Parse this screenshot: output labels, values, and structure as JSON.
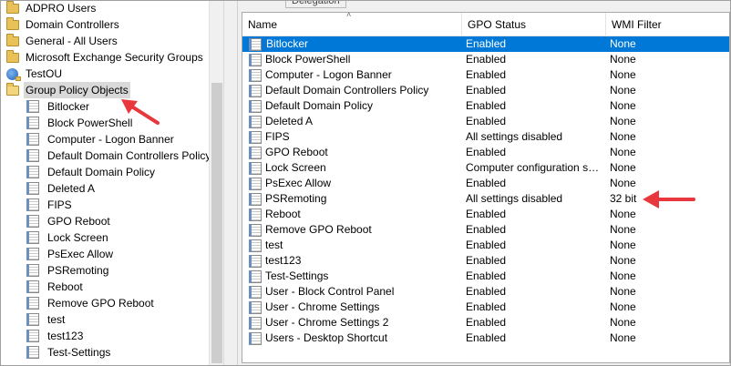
{
  "tree": {
    "items": [
      {
        "label": "ADPRO Users",
        "icon": "folder-icon",
        "level": 0
      },
      {
        "label": "Domain Controllers",
        "icon": "folder-icon",
        "level": 0
      },
      {
        "label": "General - All Users",
        "icon": "folder-icon",
        "level": 0
      },
      {
        "label": "Microsoft Exchange Security Groups",
        "icon": "folder-icon",
        "level": 0
      },
      {
        "label": "TestOU",
        "icon": "ou-icon",
        "level": 0
      },
      {
        "label": "Group Policy Objects",
        "icon": "folder-open-icon",
        "level": 0,
        "selected": true
      },
      {
        "label": "Bitlocker",
        "icon": "gpo-icon",
        "level": 1
      },
      {
        "label": "Block PowerShell",
        "icon": "gpo-icon",
        "level": 1
      },
      {
        "label": "Computer - Logon Banner",
        "icon": "gpo-icon",
        "level": 1
      },
      {
        "label": "Default Domain Controllers Policy",
        "icon": "gpo-icon",
        "level": 1
      },
      {
        "label": "Default Domain Policy",
        "icon": "gpo-icon",
        "level": 1
      },
      {
        "label": "Deleted A",
        "icon": "gpo-icon",
        "level": 1
      },
      {
        "label": "FIPS",
        "icon": "gpo-icon",
        "level": 1
      },
      {
        "label": "GPO Reboot",
        "icon": "gpo-icon",
        "level": 1
      },
      {
        "label": "Lock Screen",
        "icon": "gpo-icon",
        "level": 1
      },
      {
        "label": "PsExec Allow",
        "icon": "gpo-icon",
        "level": 1
      },
      {
        "label": "PSRemoting",
        "icon": "gpo-icon",
        "level": 1
      },
      {
        "label": "Reboot",
        "icon": "gpo-icon",
        "level": 1
      },
      {
        "label": "Remove GPO Reboot",
        "icon": "gpo-icon",
        "level": 1
      },
      {
        "label": "test",
        "icon": "gpo-icon",
        "level": 1
      },
      {
        "label": "test123",
        "icon": "gpo-icon",
        "level": 1
      },
      {
        "label": "Test-Settings",
        "icon": "gpo-icon",
        "level": 1
      }
    ]
  },
  "tab": {
    "label": "Delegation"
  },
  "table": {
    "columns": [
      "Name",
      "GPO Status",
      "WMI Filter"
    ],
    "rows": [
      {
        "name": "Bitlocker",
        "status": "Enabled",
        "wmi": "None",
        "selected": true
      },
      {
        "name": "Block PowerShell",
        "status": "Enabled",
        "wmi": "None"
      },
      {
        "name": "Computer - Logon Banner",
        "status": "Enabled",
        "wmi": "None"
      },
      {
        "name": "Default Domain Controllers Policy",
        "status": "Enabled",
        "wmi": "None"
      },
      {
        "name": "Default Domain Policy",
        "status": "Enabled",
        "wmi": "None"
      },
      {
        "name": "Deleted A",
        "status": "Enabled",
        "wmi": "None"
      },
      {
        "name": "FIPS",
        "status": "All settings disabled",
        "wmi": "None"
      },
      {
        "name": "GPO Reboot",
        "status": "Enabled",
        "wmi": "None"
      },
      {
        "name": "Lock Screen",
        "status": "Computer configuration settin...",
        "wmi": "None"
      },
      {
        "name": "PsExec Allow",
        "status": "Enabled",
        "wmi": "None"
      },
      {
        "name": "PSRemoting",
        "status": "All settings disabled",
        "wmi": "32 bit"
      },
      {
        "name": "Reboot",
        "status": "Enabled",
        "wmi": "None"
      },
      {
        "name": "Remove GPO Reboot",
        "status": "Enabled",
        "wmi": "None"
      },
      {
        "name": "test",
        "status": "Enabled",
        "wmi": "None"
      },
      {
        "name": "test123",
        "status": "Enabled",
        "wmi": "None"
      },
      {
        "name": "Test-Settings",
        "status": "Enabled",
        "wmi": "None"
      },
      {
        "name": "User - Block Control Panel",
        "status": "Enabled",
        "wmi": "None"
      },
      {
        "name": "User - Chrome Settings",
        "status": "Enabled",
        "wmi": "None"
      },
      {
        "name": "User - Chrome Settings 2",
        "status": "Enabled",
        "wmi": "None"
      },
      {
        "name": "Users - Desktop Shortcut",
        "status": "Enabled",
        "wmi": "None"
      }
    ]
  },
  "colors": {
    "selection": "#0078d7",
    "annotation_arrow": "#e8383d",
    "tree_selection": "#d9d9d9"
  }
}
